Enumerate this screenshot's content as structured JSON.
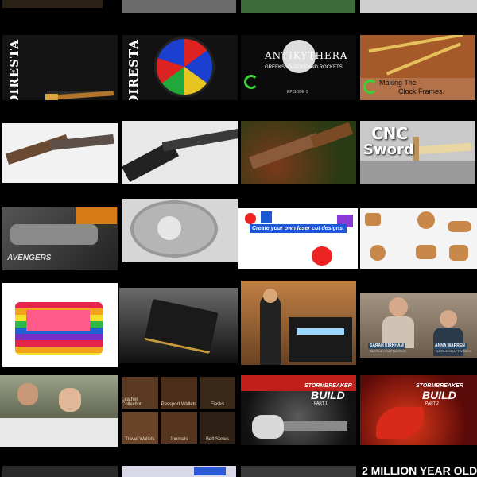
{
  "tiles": {
    "diresta_hammer": {
      "brand": "DIRESTA"
    },
    "diresta_stained_glass": {
      "brand": "DIRESTA"
    },
    "antikythera": {
      "title": "ANTIKYTHERA",
      "subtitle": "GREEKS, CLOCKS AND ROCKETS",
      "episode": "EPISODE 1"
    },
    "clock_frames": {
      "title_line1": "Making The",
      "title_line2": "Clock Frames."
    },
    "cnc_sword": {
      "line1": "CNC",
      "line2": "Sword"
    },
    "avengers": {
      "logo": "AVENGERS"
    },
    "laser_cut": {
      "banner": "Create your own laser cut designs."
    },
    "two_people": {
      "name1": "SARAH KIRKHAM",
      "role1": "TACTILE CRAFTWORKS",
      "name2": "ANNA WARREN",
      "role2": "TACTILE CRAFTWORKS"
    },
    "leather_grid": {
      "cells": [
        "Leather Collection",
        "Passport Wallets",
        "Flasks",
        "Travel Wallets",
        "Journals",
        "Belt Series"
      ]
    },
    "stormbreaker1": {
      "title": "STORMBREAKER",
      "build": "BUILD",
      "part": "PART 1"
    },
    "stormbreaker2": {
      "title": "STORMBREAKER",
      "build": "BUILD",
      "part": "PART 2"
    },
    "million": {
      "text": "2 MILLION YEAR OLD"
    }
  },
  "colors": {
    "background": "#000000",
    "accent_green": "#3ad13a",
    "stormbreaker_red": "#c0201a"
  }
}
